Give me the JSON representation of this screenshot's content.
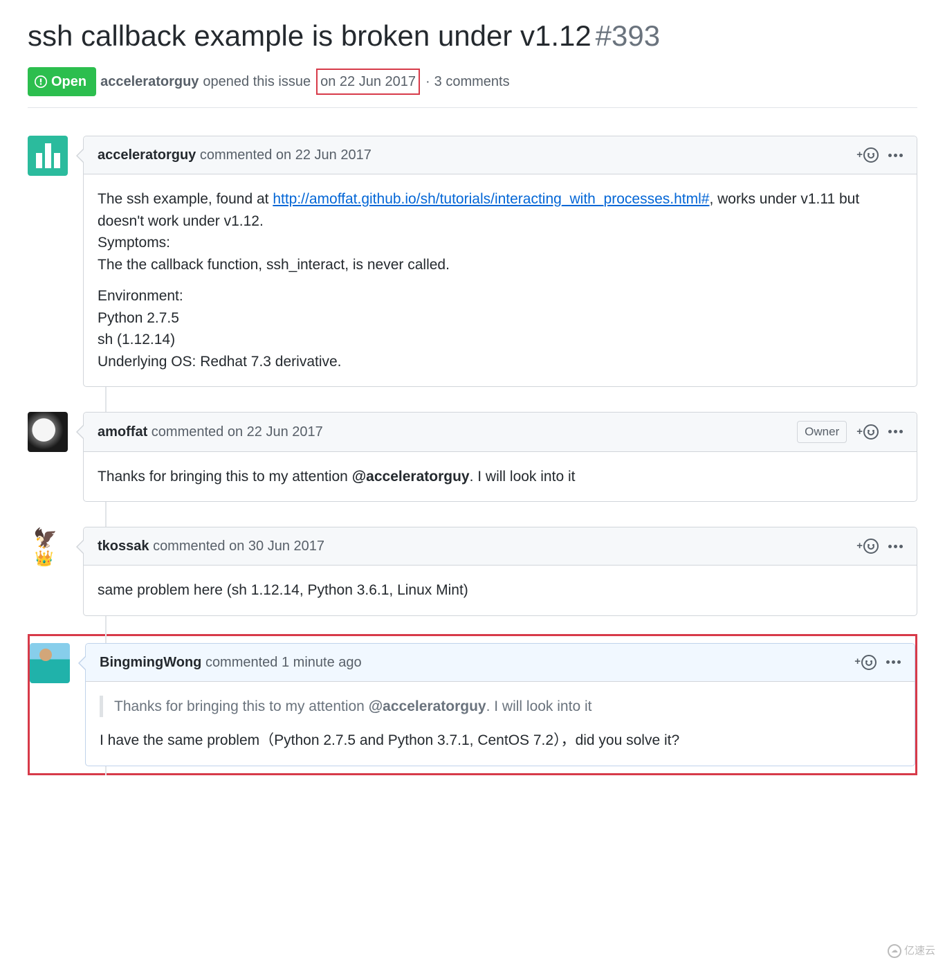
{
  "issue": {
    "title": "ssh callback example is broken under v1.12",
    "number": "#393",
    "state": "Open",
    "opener": "acceleratorguy",
    "opened_text": "opened this issue",
    "opened_date": "on 22 Jun 2017",
    "dot": "·",
    "comment_count": "3 comments"
  },
  "comments": [
    {
      "author": "acceleratorguy",
      "action": "commented",
      "date": "on 22 Jun 2017",
      "body": {
        "pre_link": "The ssh example, found at ",
        "link": "http://amoffat.github.io/sh/tutorials/interacting_with_processes.html#",
        "post_link": ", works under v1.11 but doesn't work under v1.12.",
        "line2": "Symptoms:",
        "line3": "The the callback function, ssh_interact, is never called.",
        "line4": "Environment:",
        "line5": "Python 2.7.5",
        "line6": "sh (1.12.14)",
        "line7": "Underlying OS: Redhat 7.3 derivative."
      }
    },
    {
      "author": "amoffat",
      "action": "commented",
      "date": "on 22 Jun 2017",
      "owner": "Owner",
      "body": {
        "pre_mention": "Thanks for bringing this to my attention ",
        "mention": "@acceleratorguy",
        "post_mention": ". I will look into it"
      }
    },
    {
      "author": "tkossak",
      "action": "commented",
      "date": "on 30 Jun 2017",
      "body": {
        "text": "same problem here (sh 1.12.14, Python 3.6.1, Linux Mint)"
      }
    },
    {
      "author": "BingmingWong",
      "action": "commented",
      "date": "1 minute ago",
      "quote": {
        "pre_mention": "Thanks for bringing this to my attention ",
        "mention": "@acceleratorguy",
        "post_mention": ". I will look into it"
      },
      "body": {
        "text": "I have the same problem（Python 2.7.5 and Python 3.7.1, CentOS 7.2），did you solve it?"
      }
    }
  ],
  "watermark": "亿速云"
}
